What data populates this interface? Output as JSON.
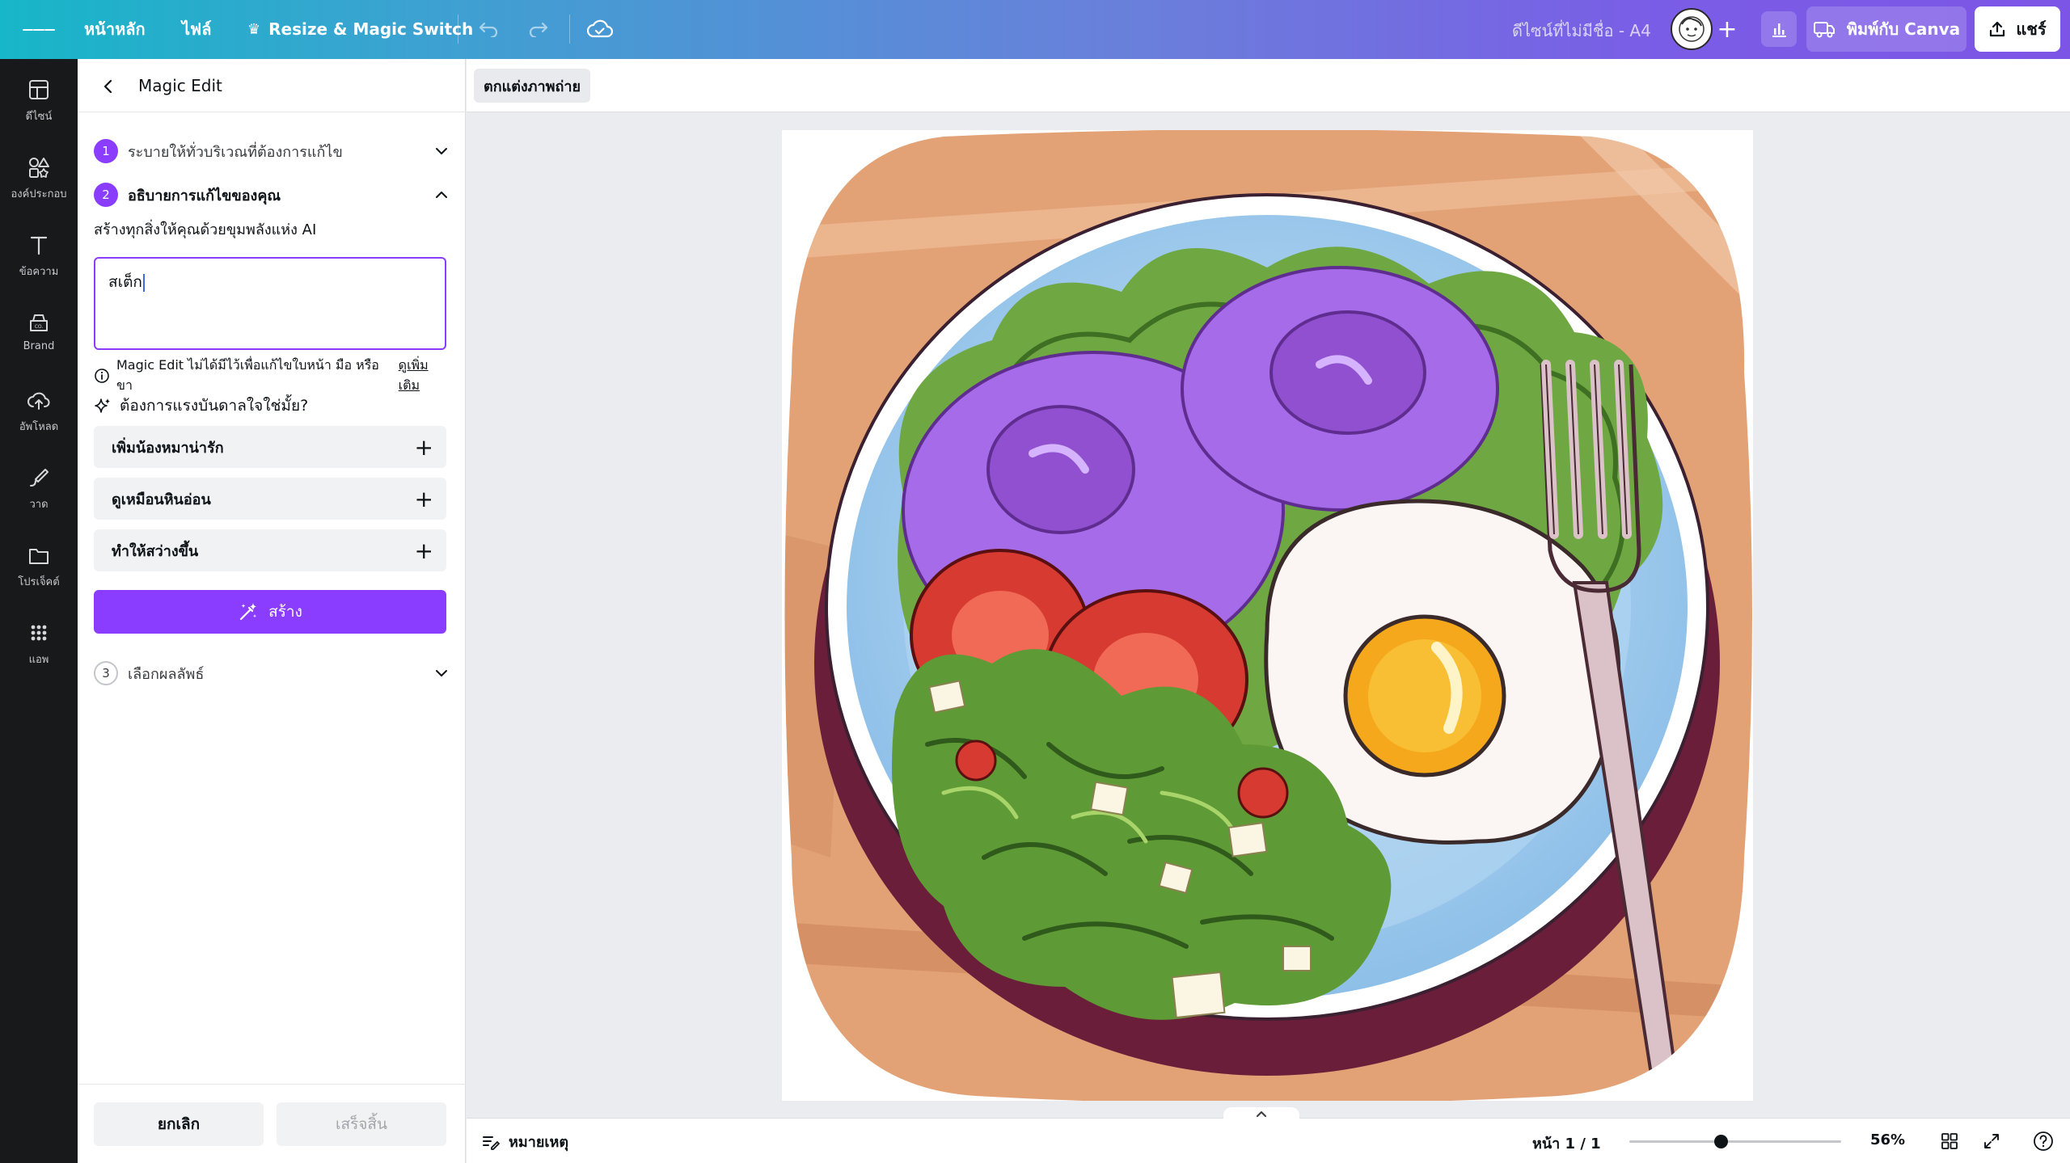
{
  "topbar": {
    "home_label": "หน้าหลัก",
    "file_label": "ไฟล์",
    "resize_label": "Resize & Magic Switch",
    "doc_title": "ดีไซน์ที่ไม่มีชื่อ - A4",
    "print_label": "พิมพ์กับ Canva",
    "share_label": "แชร์"
  },
  "rail": {
    "items": [
      {
        "label": "ดีไซน์",
        "icon": "layout-icon"
      },
      {
        "label": "องค์ประกอบ",
        "icon": "elements-icon"
      },
      {
        "label": "ข้อความ",
        "icon": "text-icon"
      },
      {
        "label": "Brand",
        "icon": "brand-icon"
      },
      {
        "label": "อัพโหลด",
        "icon": "upload-icon"
      },
      {
        "label": "วาด",
        "icon": "draw-icon"
      },
      {
        "label": "โปรเจ็คต์",
        "icon": "folder-icon"
      },
      {
        "label": "แอพ",
        "icon": "apps-icon"
      }
    ]
  },
  "panel": {
    "title": "Magic Edit",
    "step1": {
      "num": "1",
      "label": "ระบายให้ทั่วบริเวณที่ต้องการแก้ไข"
    },
    "step2": {
      "num": "2",
      "label": "อธิบายการแก้ไขของคุณ"
    },
    "subtitle": "สร้างทุกสิ่งให้คุณด้วยขุมพลังแห่ง AI",
    "prompt_value": "สเต็ก",
    "info_text": "Magic Edit ไม่ได้มีไว้เพื่อแก้ไขใบหน้า มือ หรือขา",
    "info_link": "ดูเพิ่มเติม",
    "inspire_label": "ต้องการแรงบันดาลใจใช่มั้ย?",
    "suggestions": [
      {
        "label": "เพิ่มน้องหมาน่ารัก"
      },
      {
        "label": "ดูเหมือนหินอ่อน"
      },
      {
        "label": "ทำให้สว่างขึ้น"
      }
    ],
    "create_label": "สร้าง",
    "step3": {
      "num": "3",
      "label": "เลือกผลลัพธ์"
    },
    "cancel_label": "ยกเลิก",
    "done_label": "เสร็จสิ้น"
  },
  "context": {
    "photo_edit_label": "ตกแต่งภาพถ่าย"
  },
  "bottombar": {
    "notes_label": "หมายเหตุ",
    "page_indicator": "หน้า 1 / 1",
    "zoom_label": "56%",
    "zoom_fraction": 0.43
  },
  "colors": {
    "accent": "#8b3dff",
    "topbar_start": "#17b6c8",
    "topbar_end": "#7d55e6",
    "rail_bg": "#18191b"
  }
}
